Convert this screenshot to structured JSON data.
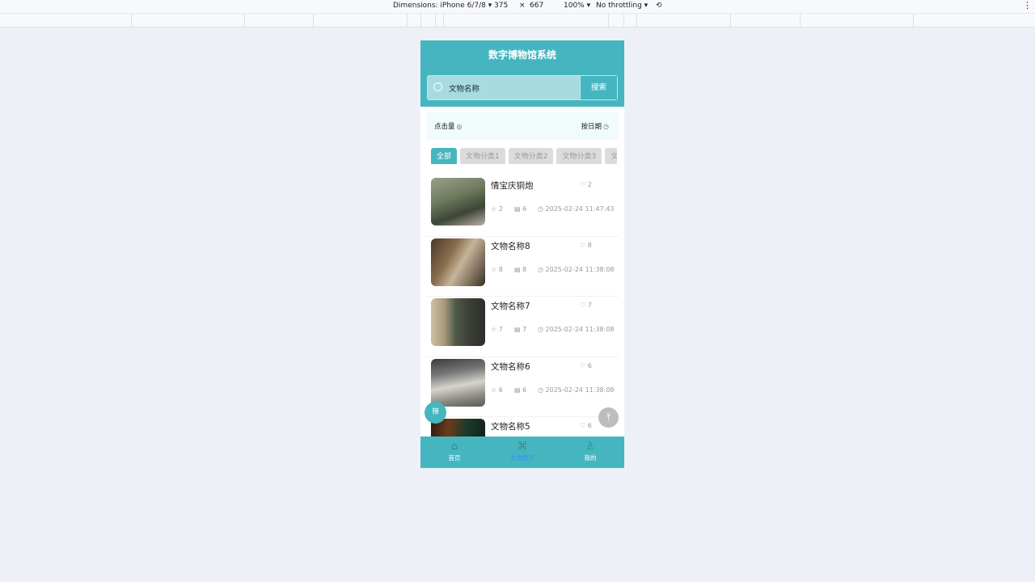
{
  "devtools": {
    "device": "Dimensions: iPhone 6/7/8 ▾",
    "width": "375",
    "times": "×",
    "height": "667",
    "zoom": "100% ▾",
    "throttle": "No throttling ▾",
    "rotate_icon": "⟲",
    "more_icon": "⋮"
  },
  "app": {
    "title": "数字博物馆系统",
    "search": {
      "placeholder": "文物名称",
      "button": "搜索"
    },
    "sort": {
      "clicks": "点击量",
      "clicks_icon": "◎",
      "by_date": "按日期",
      "date_icon": "◷"
    },
    "categories": [
      "全部",
      "文物分类1",
      "文物分类2",
      "文物分类3",
      "文物分类4"
    ],
    "items": [
      {
        "name": "情宝庆铜炮",
        "likes": "2",
        "stars": "2",
        "views": "6",
        "date": "2025-02-24 11:47:43"
      },
      {
        "name": "文物名称8",
        "likes": "8",
        "stars": "8",
        "views": "8",
        "date": "2025-02-24 11:38:08"
      },
      {
        "name": "文物名称7",
        "likes": "7",
        "stars": "7",
        "views": "7",
        "date": "2025-02-24 11:38:08"
      },
      {
        "name": "文物名称6",
        "likes": "6",
        "stars": "6",
        "views": "6",
        "date": "2025-02-24 11:38:08"
      },
      {
        "name": "文物名称5",
        "likes": "6",
        "stars": "",
        "views": "",
        "date": ""
      }
    ],
    "icons": {
      "like": "♡",
      "star": "☆",
      "view": "▤",
      "clock": "◷"
    },
    "fab": "筛",
    "top_button": "⤒",
    "tabs": [
      {
        "label": "首页",
        "icon": "⌂"
      },
      {
        "label": "文物展示",
        "icon": "⌘"
      },
      {
        "label": "我的",
        "icon": "♙"
      }
    ]
  },
  "colors": {
    "primary": "#45b6c0",
    "active_tab": "#3d8bff",
    "page_bg": "#edf1f7"
  }
}
